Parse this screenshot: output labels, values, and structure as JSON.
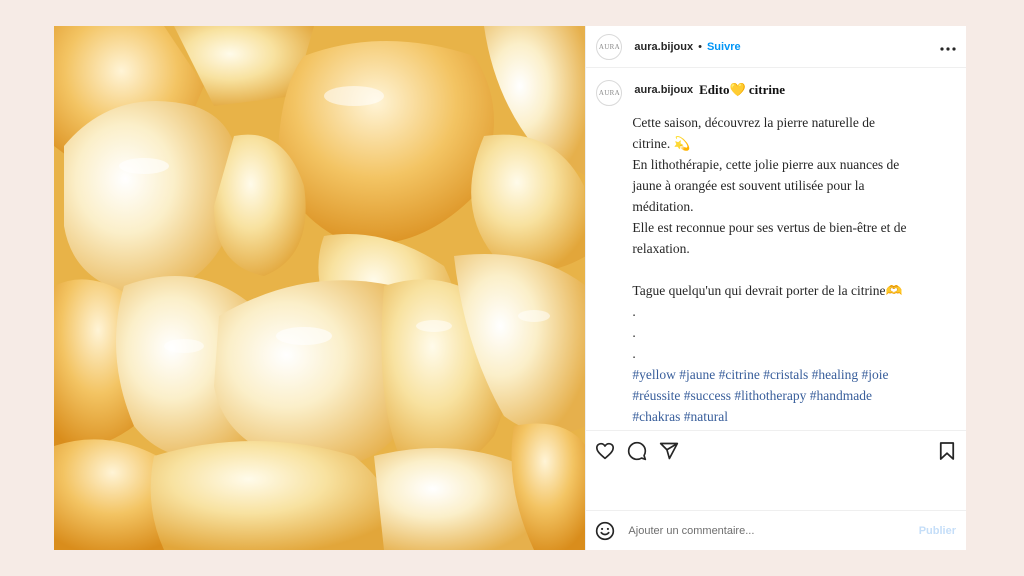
{
  "colors": {
    "page_bg": "#f6ebe6",
    "follow_blue": "#0095f6",
    "hashtag_blue": "#385e9b",
    "publish_disabled": "#c5def8"
  },
  "header": {
    "avatar_text": "AURA",
    "username": "aura.bijoux",
    "separator": "•",
    "follow_label": "Suivre",
    "more_icon": "more-horizontal-icon"
  },
  "caption": {
    "avatar_text": "AURA",
    "username": "aura.bijoux",
    "title": "Edito💛 citrine",
    "lines": [
      "Cette saison, découvrez la pierre naturelle de",
      "citrine. 💫",
      "En lithothérapie, cette jolie pierre aux nuances de",
      "jaune à orangée est souvent utilisée pour la",
      "méditation.",
      "Elle est reconnue pour ses vertus de bien-être et de",
      "relaxation."
    ],
    "tag_someone": "Tague quelqu'un qui devrait porter de la citrine🫶",
    "dots": [
      ".",
      ".",
      "."
    ],
    "hashtag_lines": [
      [
        "#yellow",
        "#jaune",
        "#citrine",
        "#cristals",
        "#healing",
        "#joie"
      ],
      [
        "#réussite",
        "#success",
        "#lithotherapy",
        "#handmade"
      ],
      [
        "#chakras",
        "#natural"
      ]
    ]
  },
  "actions": {
    "like_icon": "heart-icon",
    "comment_icon": "comment-bubble-icon",
    "share_icon": "send-icon",
    "save_icon": "bookmark-icon"
  },
  "comment_bar": {
    "emoji_icon": "emoji-smile-icon",
    "placeholder": "Ajouter un commentaire...",
    "publish_label": "Publier"
  }
}
